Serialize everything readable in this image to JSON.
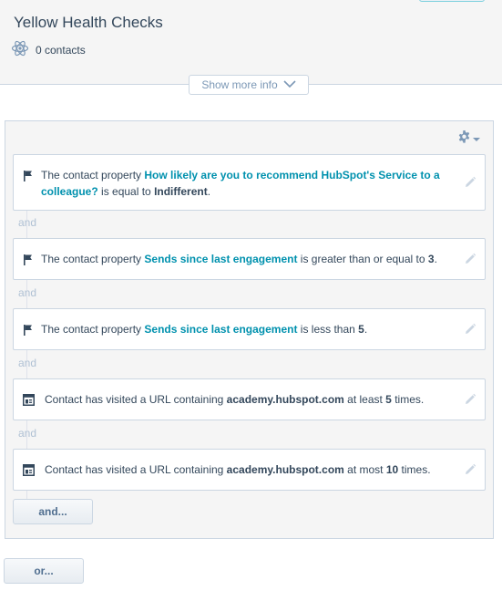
{
  "list": {
    "title": "Yellow Health Checks",
    "contact_count": "0 contacts",
    "show_more_label": "Show more info"
  },
  "colors": {
    "link": "#0091ae",
    "border": "#cbd6e2",
    "muted": "#b0c1d4"
  },
  "filters": [
    {
      "icon": "flag-icon",
      "pre": "The contact property ",
      "property": "How likely are you to recommend HubSpot's Service to a colleague?",
      "op": " is equal to ",
      "value": "Indifferent",
      "post": "."
    },
    {
      "icon": "flag-icon",
      "pre": "The contact property ",
      "property": "Sends since last engagement",
      "op": " is greater than or equal to ",
      "value": "3",
      "post": "."
    },
    {
      "icon": "flag-icon",
      "pre": "The contact property ",
      "property": "Sends since last engagement",
      "op": " is less than ",
      "value": "5",
      "post": "."
    },
    {
      "icon": "page-icon",
      "pre": "Contact has visited a URL containing ",
      "url": "academy.hubspot.com",
      "mid": " at least ",
      "count": "5",
      "post": " times."
    },
    {
      "icon": "page-icon",
      "pre": "Contact has visited a URL containing ",
      "url": "academy.hubspot.com",
      "mid": " at most ",
      "count": "10",
      "post": " times."
    }
  ],
  "and_separator": "and",
  "buttons": {
    "and_label": "and...",
    "or_label": "or..."
  }
}
